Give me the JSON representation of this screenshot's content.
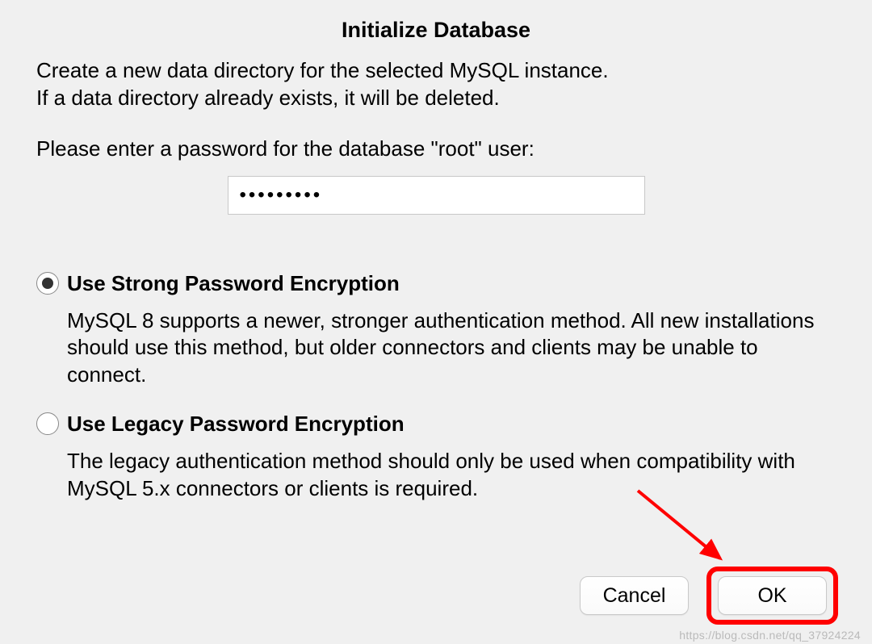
{
  "dialog": {
    "title": "Initialize Database",
    "description_line1": "Create a new data directory for the selected MySQL instance.",
    "description_line2": "If a data directory already exists, it will be deleted.",
    "prompt": "Please enter a password for the database \"root\" user:",
    "password_value": "•••••••••"
  },
  "options": {
    "strong": {
      "label": "Use Strong Password Encryption",
      "description": "MySQL 8 supports a newer, stronger authentication method. All new installations should use this method, but older connectors and clients may be unable to connect.",
      "selected": true
    },
    "legacy": {
      "label": "Use Legacy Password Encryption",
      "description": "The legacy authentication method should only be used when compatibility with MySQL 5.x connectors or clients is required.",
      "selected": false
    }
  },
  "buttons": {
    "cancel": "Cancel",
    "ok": "OK"
  },
  "watermark": "https://blog.csdn.net/qq_37924224"
}
